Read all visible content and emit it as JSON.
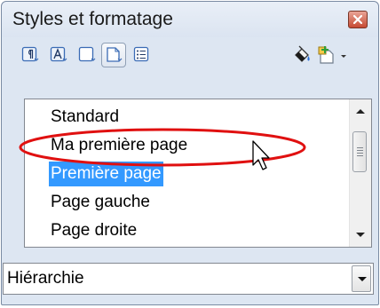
{
  "window": {
    "title": "Styles et formatage"
  },
  "toolbar": {
    "buttons": [
      {
        "icon": "paragraph-styles-icon"
      },
      {
        "icon": "character-styles-icon"
      },
      {
        "icon": "frame-styles-icon"
      },
      {
        "icon": "page-styles-icon",
        "pressed": true
      },
      {
        "icon": "list-styles-icon"
      },
      {
        "icon": "fill-format-mode-icon"
      },
      {
        "icon": "new-style-from-selection-icon"
      }
    ]
  },
  "styles_list": {
    "items": [
      {
        "label": "Standard"
      },
      {
        "label": "Ma première page"
      },
      {
        "label": "Première page",
        "selected": true
      },
      {
        "label": "Page gauche"
      },
      {
        "label": "Page droite"
      }
    ]
  },
  "filter_dropdown": {
    "value": "Hiérarchie"
  },
  "colors": {
    "selection": "#3399ff",
    "annotation_ellipse": "#e01010",
    "window_background": "#dde6f2"
  }
}
